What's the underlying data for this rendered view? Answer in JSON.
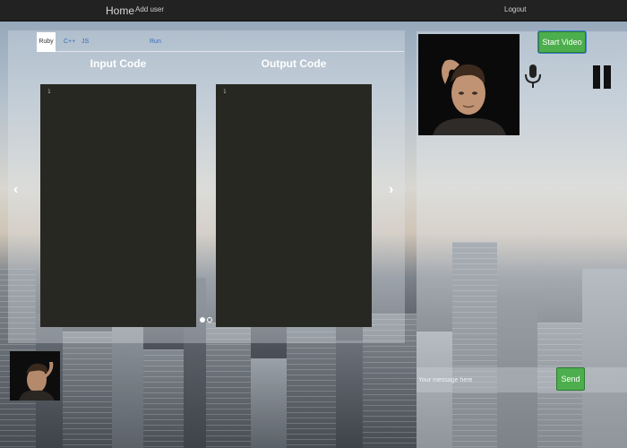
{
  "navbar": {
    "home": "Home",
    "add_user": "Add user",
    "logout": "Logout"
  },
  "editor": {
    "tabs": [
      {
        "label": "Ruby",
        "active": true
      },
      {
        "label": "C++",
        "active": false
      },
      {
        "label": "JS",
        "active": false
      }
    ],
    "run_label": "Run",
    "input_title": "Input Code",
    "output_title": "Output Code",
    "input_line_number": "1",
    "output_line_number": "1",
    "carousel": {
      "slides": 2,
      "active_slide": 1
    }
  },
  "chat": {
    "start_video_label": "Start Video",
    "message_placeholder": "Your message here",
    "send_label": "Send"
  },
  "icons": {
    "mic": "microphone-icon",
    "pause": "pause-icon",
    "prev": "chevron-left-icon",
    "next": "chevron-right-icon"
  },
  "colors": {
    "navbar": "#222222",
    "button_green": "#4cae4c",
    "editor_bg": "#282823",
    "link_blue": "#3a6ec0"
  }
}
